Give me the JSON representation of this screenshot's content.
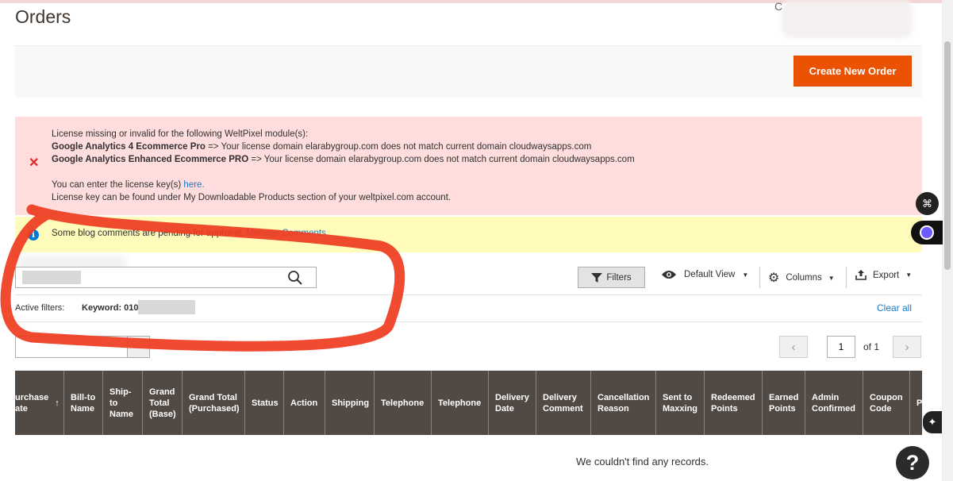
{
  "page": {
    "title": "Orders"
  },
  "user": {
    "initial": "C"
  },
  "actions": {
    "create_label": "Create New Order"
  },
  "messages": {
    "error": {
      "line1": "License missing or invalid for the following WeltPixel module(s):",
      "module1_name": "Google Analytics 4 Ecommerce Pro",
      "module1_text": " => Your license domain elarabygroup.com does not match current domain cloudwaysapps.com",
      "module2_name": "Google Analytics Enhanced Ecommerce PRO",
      "module2_text": " => Your license domain elarabygroup.com does not match current domain cloudwaysapps.com",
      "enter_text": "You can enter the license key(s) ",
      "here_link": "here.",
      "found_text": "License key can be found under My Downloadable Products section of your weltpixel.com account."
    },
    "notice": {
      "text": "Some blog comments are pending for approval. ",
      "link": "Manage Comments"
    }
  },
  "toolbar": {
    "search_value": "",
    "filters_label": "Filters",
    "view_label": "Default View",
    "columns_label": "Columns",
    "export_label": "Export"
  },
  "active_filters": {
    "label": "Active filters:",
    "keyword": "Keyword: 010",
    "clear_label": "Clear all"
  },
  "pager": {
    "current": "1",
    "of_label": "of 1"
  },
  "grid": {
    "columns": [
      "urchase\nate",
      "Bill-to\nName",
      "Ship-\nto\nName",
      "Grand\nTotal\n(Base)",
      "Grand Total\n(Purchased)",
      "Status",
      "Action",
      "Shipping",
      "Telephone",
      "Telephone",
      "Delivery\nDate",
      "Delivery\nComment",
      "Cancellation\nReason",
      "Sent to\nMaxxing",
      "Redeemed\nPoints",
      "Earned\nPoints",
      "Admin\nConfirmed",
      "Coupon\nCode",
      "P"
    ],
    "empty_text": "We couldn't find any records."
  },
  "colors": {
    "accent": "#eb5202",
    "header_bg": "#514943",
    "error_bg": "#ffdddd",
    "notice_bg": "#fffbbb",
    "link": "#1979c3"
  }
}
